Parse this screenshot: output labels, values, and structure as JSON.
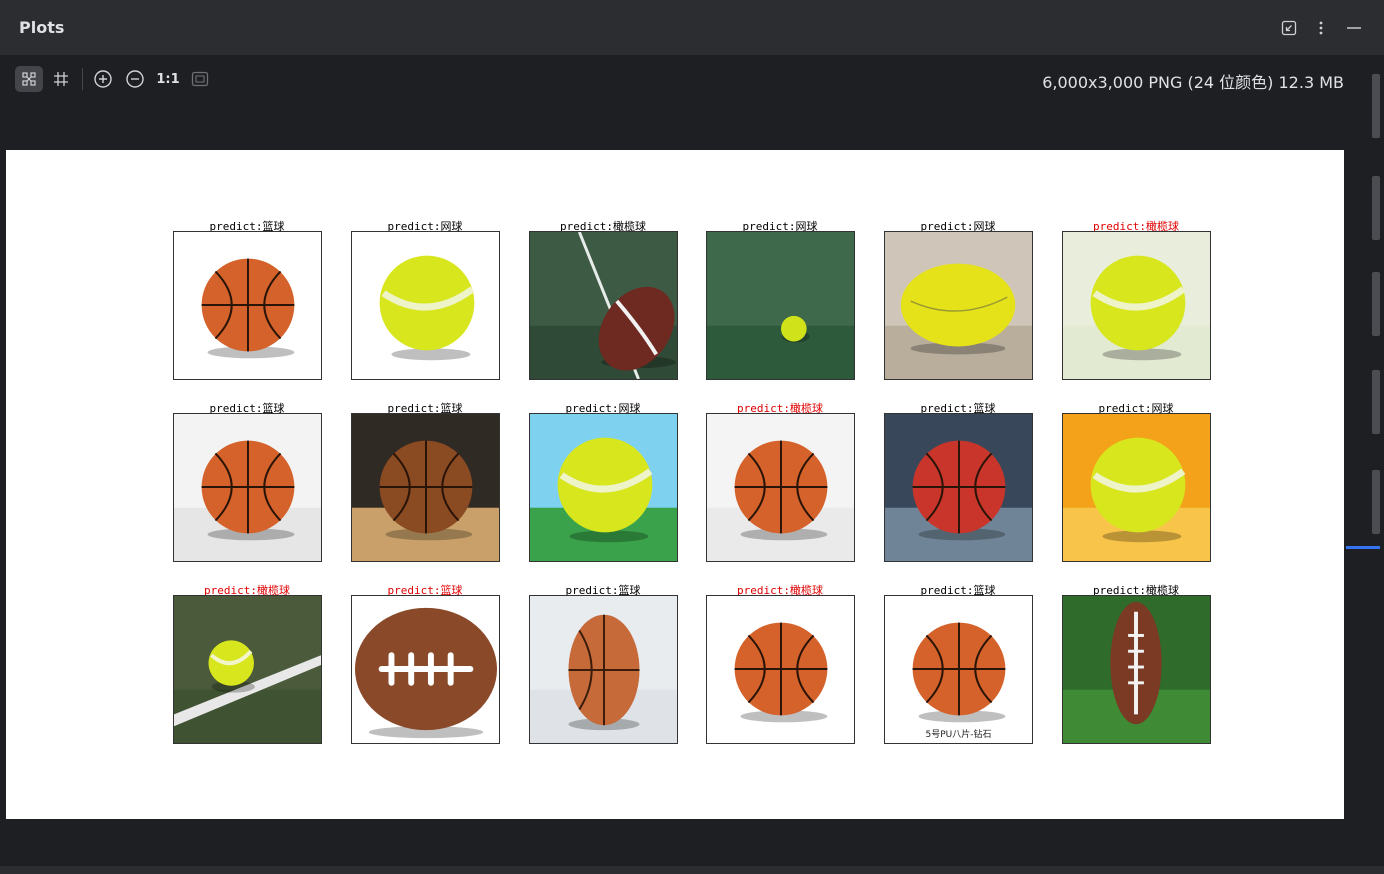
{
  "panel": {
    "title": "Plots"
  },
  "toolbar": {
    "zoom_actual_label": "1:1",
    "image_info": "6,000x3,000 PNG (24 位颜色) 12.3 MB"
  },
  "grid": {
    "rows": [
      [
        {
          "label": "predict:篮球",
          "correct": true,
          "kind": "basketball",
          "bg": "#ffffff",
          "ground": "#ffffff"
        },
        {
          "label": "predict:网球",
          "correct": true,
          "kind": "tennis",
          "bg": "#ffffff",
          "ground": "#ffffff"
        },
        {
          "label": "predict:橄榄球",
          "correct": true,
          "kind": "football",
          "bg": "#3d5a45",
          "ground": "#2f4a37"
        },
        {
          "label": "predict:网球",
          "correct": true,
          "kind": "tennis-small",
          "bg": "#3e6a4b",
          "ground": "#2e5a3c"
        },
        {
          "label": "predict:网球",
          "correct": true,
          "kind": "tennis-head",
          "bg": "#cfc6b9",
          "ground": "#b9ae9c"
        },
        {
          "label": "predict:橄榄球",
          "correct": false,
          "kind": "tennis",
          "bg": "#e8eedb",
          "ground": "#e3ead2"
        }
      ],
      [
        {
          "label": "predict:篮球",
          "correct": true,
          "kind": "basketball",
          "bg": "#f3f3f3",
          "ground": "#e6e6e6"
        },
        {
          "label": "predict:篮球",
          "correct": true,
          "kind": "basketball-brown",
          "bg": "#2f2a23",
          "ground": "#c9a06a"
        },
        {
          "label": "predict:网球",
          "correct": true,
          "kind": "tennis",
          "bg": "#7fd1f0",
          "ground": "#3aa24a"
        },
        {
          "label": "predict:橄榄球",
          "correct": false,
          "kind": "basketball",
          "bg": "#f4f4f4",
          "ground": "#eaeaea"
        },
        {
          "label": "predict:篮球",
          "correct": true,
          "kind": "basketball-red",
          "bg": "#38485a",
          "ground": "#6f8496"
        },
        {
          "label": "predict:网球",
          "correct": true,
          "kind": "tennis",
          "bg": "#f3a21a",
          "ground": "#f8c54a"
        }
      ],
      [
        {
          "label": "predict:橄榄球",
          "correct": false,
          "kind": "tennis-court",
          "bg": "#4a5a3a",
          "ground": "#3f5232"
        },
        {
          "label": "predict:篮球",
          "correct": false,
          "kind": "football-brown",
          "bg": "#ffffff",
          "ground": "#ffffff"
        },
        {
          "label": "predict:篮球",
          "correct": true,
          "kind": "basketball-tall",
          "bg": "#e9ecef",
          "ground": "#dfe3e7"
        },
        {
          "label": "predict:橄榄球",
          "correct": false,
          "kind": "basketball",
          "bg": "#ffffff",
          "ground": "#ffffff"
        },
        {
          "label": "predict:篮球",
          "correct": true,
          "kind": "basketball",
          "bg": "#ffffff",
          "ground": "#ffffff"
        },
        {
          "label": "predict:橄榄球",
          "correct": true,
          "kind": "football-stand",
          "bg": "#2f6b2a",
          "ground": "#3f8a35"
        }
      ]
    ]
  },
  "image_captions": {
    "row3_col5": "5号PU八片-钻石"
  },
  "colors": {
    "wrong_label": "#e00000",
    "accent": "#3574f0"
  }
}
